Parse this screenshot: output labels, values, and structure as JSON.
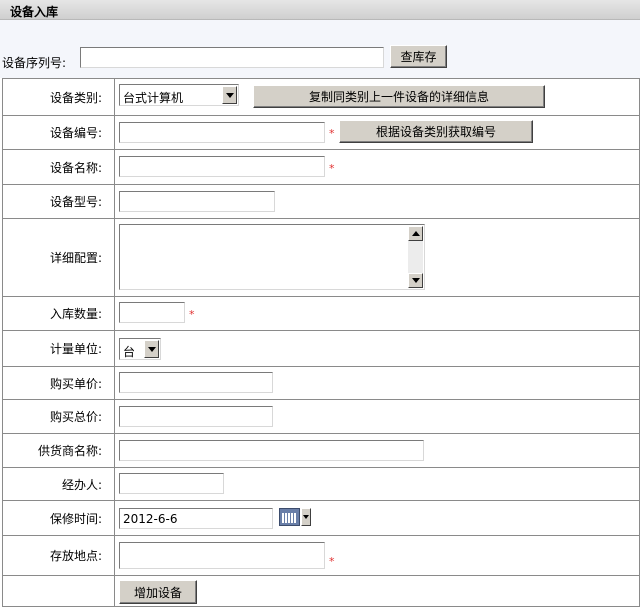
{
  "header": {
    "title": "设备入库"
  },
  "search": {
    "label": "设备序列号:",
    "value": "",
    "button": "查库存"
  },
  "fields": {
    "category": {
      "label": "设备类别:",
      "selected": "台式计算机",
      "copy_button": "复制同类别上一件设备的详细信息"
    },
    "code": {
      "label": "设备编号:",
      "value": "",
      "required": "*",
      "gen_button": "根据设备类别获取编号"
    },
    "name": {
      "label": "设备名称:",
      "value": "",
      "required": "*"
    },
    "model": {
      "label": "设备型号:",
      "value": ""
    },
    "detail": {
      "label": "详细配置:",
      "value": ""
    },
    "quantity": {
      "label": "入库数量:",
      "value": "",
      "required": "*"
    },
    "unit": {
      "label": "计量单位:",
      "selected": "台"
    },
    "unit_price": {
      "label": "购买单价:",
      "value": ""
    },
    "total_price": {
      "label": "购买总价:",
      "value": ""
    },
    "supplier": {
      "label": "供货商名称:",
      "value": ""
    },
    "handler": {
      "label": "经办人:",
      "value": ""
    },
    "warranty": {
      "label": "保修时间:",
      "value": "2012-6-6"
    },
    "location": {
      "label": "存放地点:",
      "value": "",
      "required": "*"
    }
  },
  "submit": {
    "label": "增加设备"
  },
  "colors": {
    "required": "#e03030",
    "button_face": "#d4d0c8",
    "header_bg": "#d8d8d8"
  }
}
